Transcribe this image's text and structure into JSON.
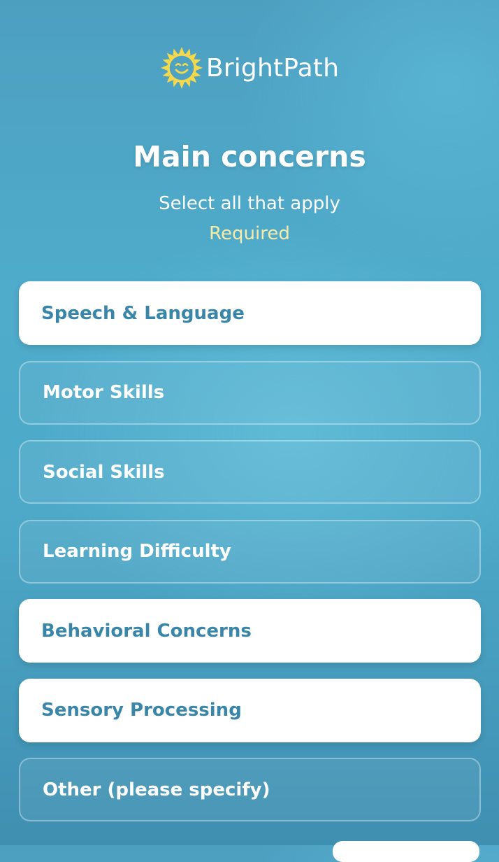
{
  "brand": {
    "name": "BrightPath",
    "logo_icon": "sun-icon",
    "logo_color": "#f5d94a"
  },
  "page": {
    "title": "Main concerns",
    "subtitle": "Select all that apply",
    "required_label": "Required"
  },
  "options": [
    {
      "label": "Speech & Language",
      "selected": true
    },
    {
      "label": "Motor Skills",
      "selected": false
    },
    {
      "label": "Social Skills",
      "selected": false
    },
    {
      "label": "Learning Difficulty",
      "selected": false
    },
    {
      "label": "Behavioral Concerns",
      "selected": true
    },
    {
      "label": "Sensory Processing",
      "selected": true
    },
    {
      "label": "Other (please specify)",
      "selected": false
    }
  ],
  "colors": {
    "selected_text": "#3a86a8",
    "required_text": "#f7ebaa"
  }
}
